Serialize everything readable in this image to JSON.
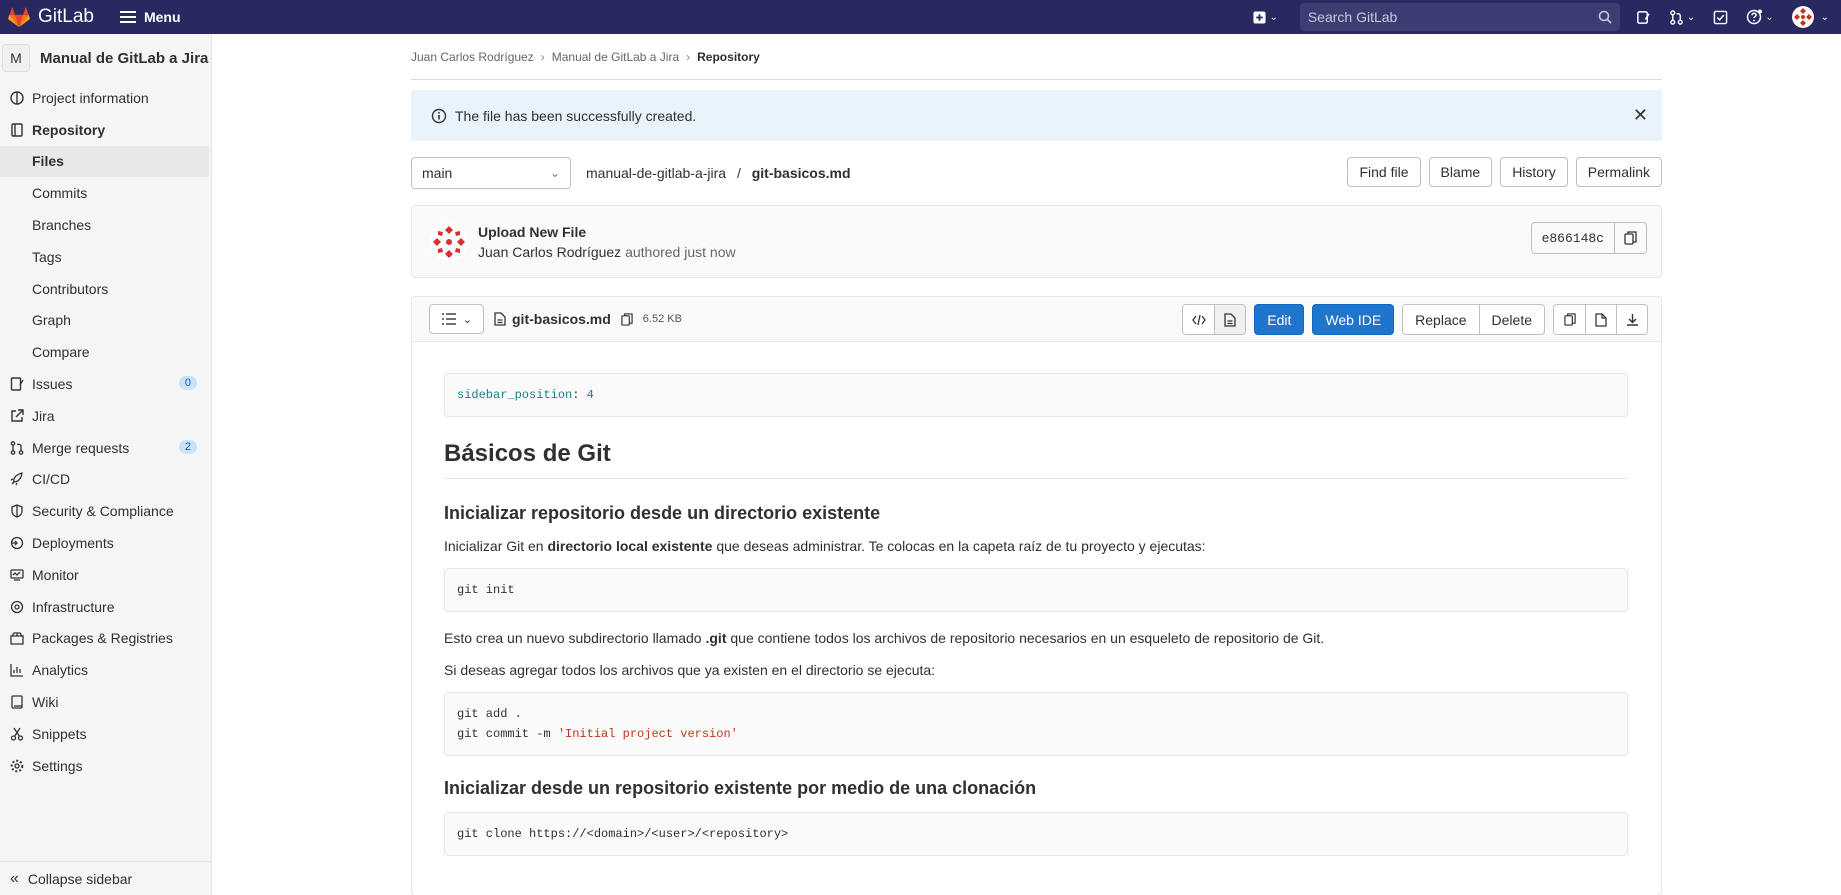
{
  "topbar": {
    "brand": "GitLab",
    "menu_label": "Menu",
    "search_placeholder": "Search GitLab"
  },
  "sidebar": {
    "project_initial": "M",
    "project_name": "Manual de GitLab a Jira",
    "items": {
      "project_information": "Project information",
      "repository": "Repository",
      "files": "Files",
      "commits": "Commits",
      "branches": "Branches",
      "tags": "Tags",
      "contributors": "Contributors",
      "graph": "Graph",
      "compare": "Compare",
      "issues": "Issues",
      "issues_count": "0",
      "jira": "Jira",
      "merge_requests": "Merge requests",
      "merge_requests_count": "2",
      "cicd": "CI/CD",
      "security": "Security & Compliance",
      "deployments": "Deployments",
      "monitor": "Monitor",
      "infrastructure": "Infrastructure",
      "packages": "Packages & Registries",
      "analytics": "Analytics",
      "wiki": "Wiki",
      "snippets": "Snippets",
      "settings": "Settings"
    },
    "collapse_label": "Collapse sidebar"
  },
  "breadcrumb": {
    "user": "Juan Carlos Rodríguez",
    "project": "Manual de GitLab a Jira",
    "current": "Repository"
  },
  "alert": {
    "message": "The file has been successfully created."
  },
  "repo_bar": {
    "branch": "main",
    "path_dir": "manual-de-gitlab-a-jira",
    "path_sep": "/",
    "path_file": "git-basicos.md",
    "find_file": "Find file",
    "blame": "Blame",
    "history": "History",
    "permalink": "Permalink"
  },
  "commit": {
    "title": "Upload New File",
    "author": "Juan Carlos Rodríguez",
    "meta": "authored just now",
    "sha": "e866148c"
  },
  "file": {
    "name": "git-basicos.md",
    "size": "6.52 KB",
    "edit": "Edit",
    "web_ide": "Web IDE",
    "replace": "Replace",
    "delete": "Delete"
  },
  "content": {
    "front_key": "sidebar_position",
    "front_colon": ":",
    "front_value": "4",
    "h1": "Básicos de Git",
    "h2_1": "Inicializar repositorio desde un directorio existente",
    "p1_a": "Inicializar Git en ",
    "p1_b": "directorio local existente",
    "p1_c": " que deseas administrar. Te colocas en la capeta raíz de tu proyecto y ejecutas:",
    "code1": "git init",
    "p2_a": "Esto crea un nuevo subdirectorio llamado ",
    "p2_b": ".git",
    "p2_c": " que contiene todos los archivos de repositorio necesarios en un esqueleto de repositorio de Git.",
    "p3": "Si deseas agregar todos los archivos que ya existen en el directorio se ejecuta:",
    "code2_l1": "git add .",
    "code2_l2_a": "git commit ",
    "code2_l2_b": "-m",
    "code2_l2_c": "'Initial project version'",
    "h2_2": "Inicializar desde un repositorio existente por medio de una clonación",
    "code3": "git clone https://<domain>/<user>/<repository>"
  },
  "colors": {
    "topbar": "#292961",
    "primary": "#1f75cb",
    "alert_bg": "#e9f3fc"
  }
}
